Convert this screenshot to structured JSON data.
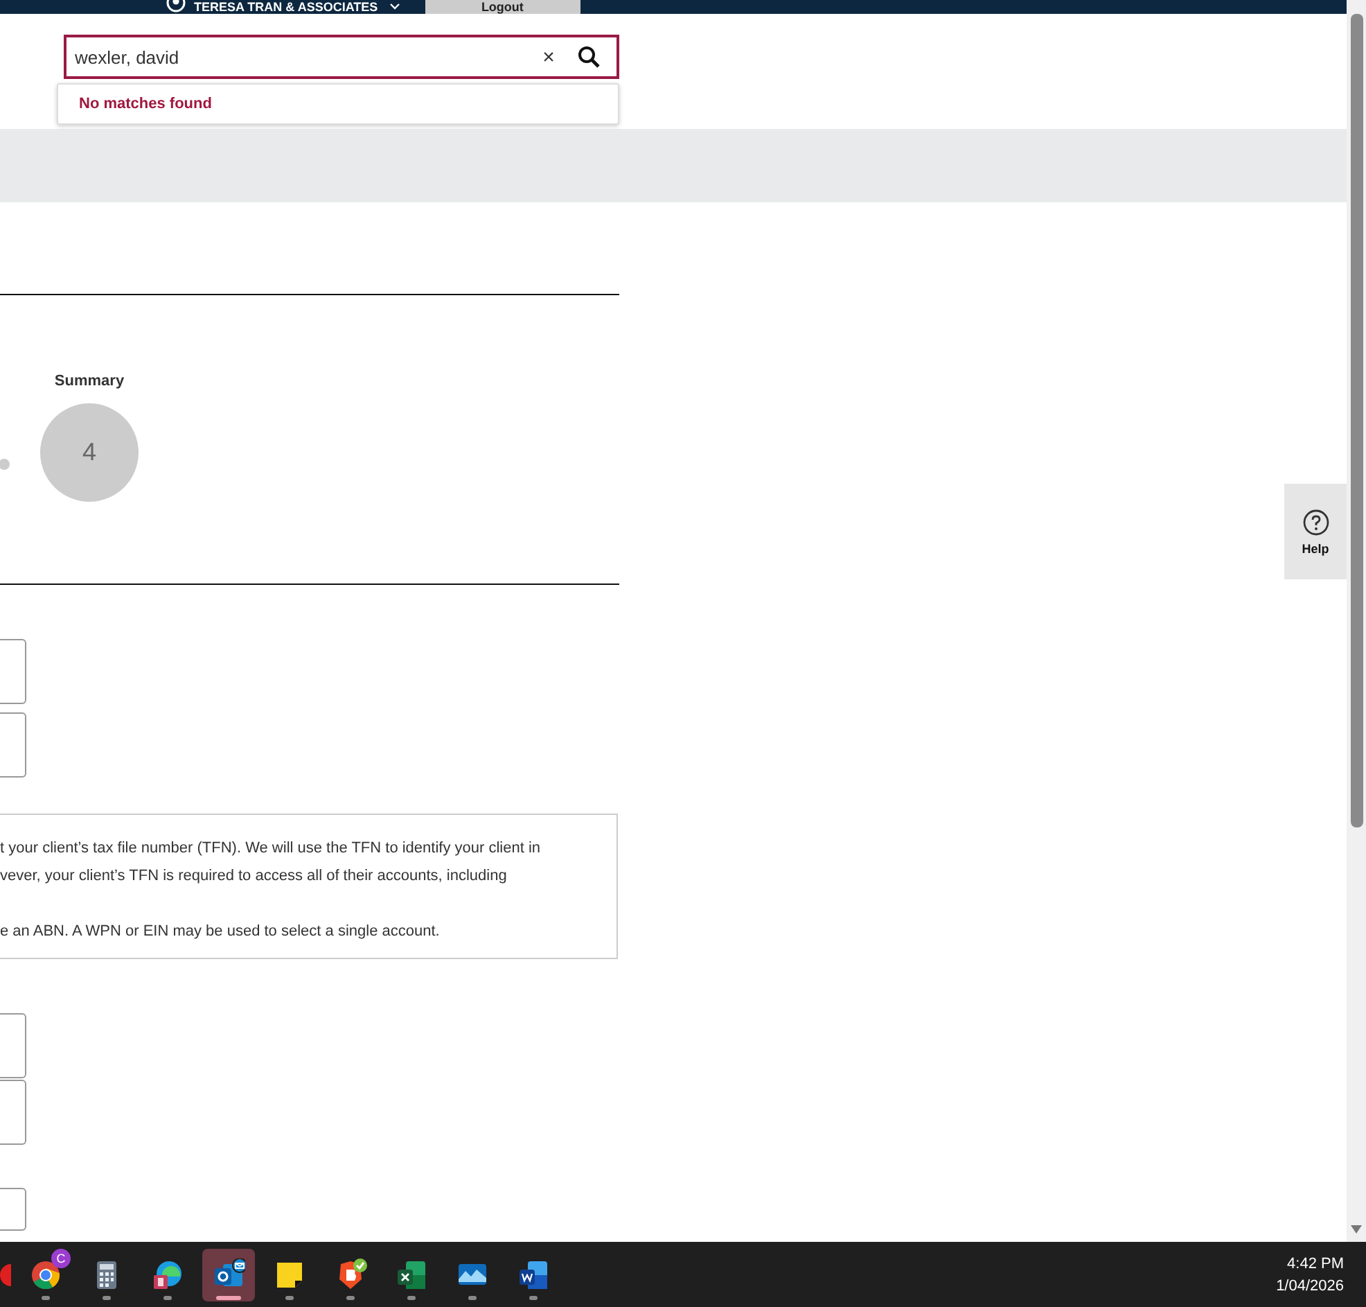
{
  "top_bar": {
    "firm": "TERESA TRAN & ASSOCIATES",
    "logout": "Logout"
  },
  "search": {
    "value": "wexler, david",
    "clear": "×",
    "results_message": "No matches found"
  },
  "stepper": {
    "steps": [
      {
        "label": "Summary",
        "number": "4",
        "selected": false
      }
    ]
  },
  "info_box": {
    "lines": [
      "t your client’s tax file number (TFN). We will use the TFN to identify your client in",
      "vever, your client’s TFN is required to access all of their accounts, including",
      "e an ABN. A WPN or EIN may be used to select a single account."
    ]
  },
  "help": {
    "label": "Help"
  },
  "taskbar": {
    "apps": [
      {
        "kind": "record",
        "selected": false
      },
      {
        "kind": "chrome",
        "badge": "C",
        "selected": false
      },
      {
        "kind": "calculator",
        "selected": false
      },
      {
        "kind": "edge",
        "selected": false
      },
      {
        "kind": "outlook",
        "selected": true
      },
      {
        "kind": "notes",
        "selected": false
      },
      {
        "kind": "brave",
        "selected": false
      },
      {
        "kind": "excel",
        "selected": false
      },
      {
        "kind": "photos",
        "selected": false
      },
      {
        "kind": "word",
        "selected": false
      }
    ],
    "time": "4:42 PM",
    "date": "1/04/2026"
  }
}
